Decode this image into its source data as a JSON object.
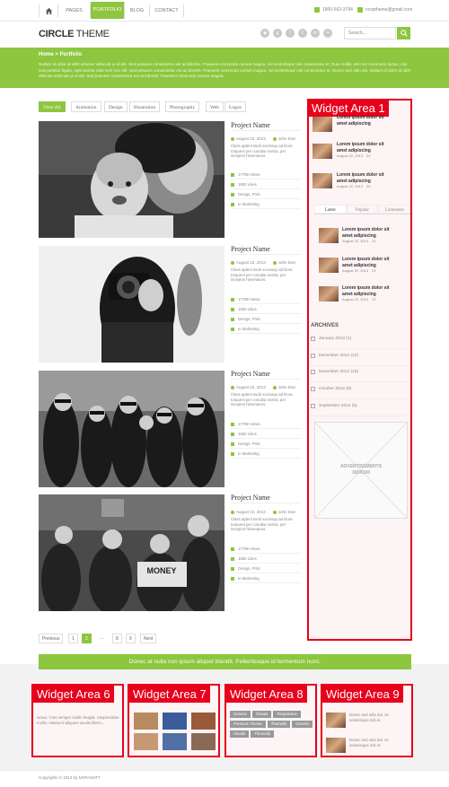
{
  "nav": {
    "items": [
      "PAGES",
      "PORTFOLIO",
      "BLOG",
      "CONTACT"
    ],
    "phone": "1800-562-3794",
    "email": "ncsptheme@gmail.com"
  },
  "header": {
    "logo_bold": "CIRCLE",
    "logo_light": " THEME",
    "search_placeholder": "Search..."
  },
  "page": {
    "breadcrumb_home": "Home",
    "breadcrumb_sep": ">",
    "breadcrumb_current": "Portfolio",
    "intro": "Nullam id dolor id nibh ultricies vehicula ut id elit. Sed posuere consectetur est at lobortis. Praesent commodo cursus magna, vel scelerisque nisl consectetur et. Duis mollis, est non commodo luctus, nisi erat porttitor ligula, eget lacinia odio sem nec elit. Sed posuere consectetur est at lobortis. Praesent commodo cursus magna, vel scelerisque nisl consectetur et. Donec sed odio dui. Nullam id dolor id nibh ultricies vehicula ut id elit. Sed posuere consectetur est at lobortis. Praesent commodo cursus magna."
  },
  "filters": [
    "View All",
    "Animation",
    "Design",
    "Illustration",
    "Photography",
    "Web",
    "Logos"
  ],
  "projects": [
    {
      "title": "Project Name",
      "date": "August 22, 2013",
      "author": "John Doe",
      "desc": "Class aptent taciti sociosqu ad litora torquent per conubia nostra, per inceptos himenaeos.",
      "views": "17798 Views",
      "likes": "1683 Likes",
      "cats": "Design, Print",
      "tags": "In Marketing"
    },
    {
      "title": "Project Name",
      "date": "August 22, 2013",
      "author": "John Doe",
      "desc": "Class aptent taciti sociosqu ad litora torquent per conubia nostra, per inceptos himenaeos.",
      "views": "17798 Views",
      "likes": "1683 Likes",
      "cats": "Design, Print",
      "tags": "In Marketing"
    },
    {
      "title": "Project Name",
      "date": "August 22, 2013",
      "author": "John Doe",
      "desc": "Class aptent taciti sociosqu ad litora torquent per conubia nostra, per inceptos himenaeos.",
      "views": "17798 Views",
      "likes": "1683 Likes",
      "cats": "Design, Print",
      "tags": "In Marketing"
    },
    {
      "title": "Project Name",
      "date": "August 22, 2013",
      "author": "John Doe",
      "desc": "Class aptent taciti sociosqu ad litora torquent per conubia nostra, per inceptos himenaeos.",
      "views": "17798 Views",
      "likes": "1683 Likes",
      "cats": "Design, Print",
      "tags": "In Marketing"
    }
  ],
  "pagination": [
    "Previous",
    "1",
    "2",
    "...",
    "8",
    "9",
    "Next"
  ],
  "sidebar": {
    "label": "Widget Area 1",
    "posts_top": [
      {
        "title": "Lorem ipsum dolor sit amet adipiscing",
        "date": "August 22, 2013",
        "comments": "22"
      },
      {
        "title": "Lorem ipsum dolor sit amet adipiscing",
        "date": "August 22, 2013",
        "comments": "22"
      }
    ],
    "tabs": [
      "Latest",
      "Popular",
      "Comments"
    ],
    "posts_tab": [
      {
        "title": "Lorem ipsum dolor sit amet adipiscing",
        "date": "August 22, 2013",
        "comments": "22"
      },
      {
        "title": "Lorem ipsum dolor sit amet adipiscing",
        "date": "August 22, 2013",
        "comments": "22"
      },
      {
        "title": "Lorem ipsum dolor sit amet adipiscing",
        "date": "August 22, 2013",
        "comments": "22"
      }
    ],
    "archives_title": "ARCHIVES",
    "archives": [
      "January 2013 (1)",
      "December 2012 (12)",
      "November 2012 (10)",
      "October 2012 (8)",
      "September 2012 (5)"
    ],
    "ads": "ADVERTISEMENTS",
    "ads_size": "300X300"
  },
  "banner": "Donec at nulla non ipsum aliquet blandit. Pellentesque id fermentum nunc.",
  "widgets": {
    "w6": {
      "label": "Widget Area 6",
      "text": "luctus. Cras semper mollis feugiat. Suspendisse mollis, massa id aliquam iaculis libero..."
    },
    "w7": {
      "label": "Widget Area 7"
    },
    "w8": {
      "label": "Widget Area 8",
      "tags": [
        "Generic",
        "Clouds",
        "Responsive",
        "Premium Theme",
        "Themeify",
        "Generic",
        "Clouds",
        "Themeify"
      ]
    },
    "w9": {
      "label": "Widget Area 9",
      "text1": "Donec sed odio dui. Ut scelerisque nisl et.",
      "text2": "Donec sed odio dui. Ut scelerisque nisl et."
    }
  },
  "footer": {
    "copyright": "Copyrights © 2013 by NOPASOFT"
  }
}
